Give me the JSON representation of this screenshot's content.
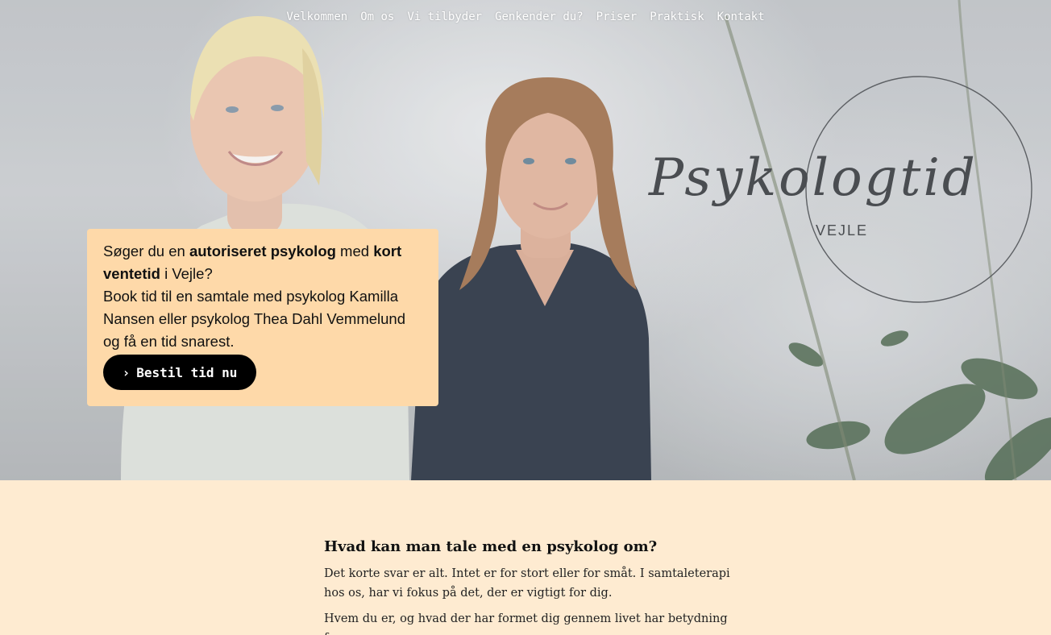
{
  "nav": {
    "items": [
      "Velkommen",
      "Om os",
      "Vi tilbyder",
      "Genkender du?",
      "Priser",
      "Praktisk",
      "Kontakt"
    ]
  },
  "logo": {
    "script_text": "Psykologtid",
    "sub_text": "VEJLE"
  },
  "hero": {
    "intro_part1": "Søger du en ",
    "intro_bold1": "autoriseret psykolog",
    "intro_part2": " med ",
    "intro_bold2": "kort ventetid",
    "intro_part3": " i Vejle?",
    "body": "Book tid til en samtale med psykolog Kamilla Nansen eller psykolog Thea Dahl Vemmelund og få en tid snarest.",
    "cta_label": "Bestil tid nu",
    "cta_icon": "chevron-right-icon"
  },
  "content": {
    "heading": "Hvad kan man tale med en psykolog om?",
    "paragraph1": "Det korte svar er alt. Intet er for stort eller for småt. I samtaleterapi hos os, har vi fokus på det, der er vigtigt for dig.",
    "paragraph2": "Hvem du er, og hvad der har formet dig gennem livet har betydning for,"
  },
  "colors": {
    "page_bg": "#feebd1",
    "info_box_bg": "#fed9a9",
    "cta_bg": "#000000",
    "cta_text": "#ffffff"
  }
}
